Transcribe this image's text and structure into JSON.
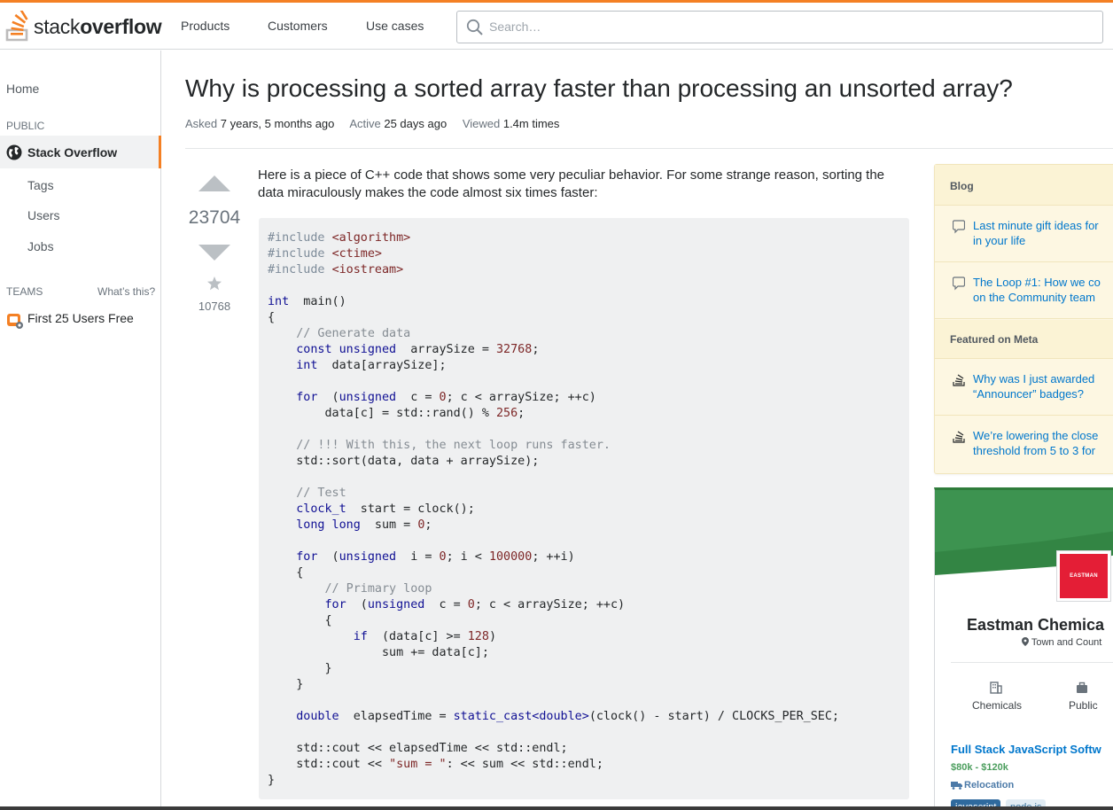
{
  "brand": {
    "logo_light": "stack",
    "logo_bold": "overflow"
  },
  "header": {
    "nav": [
      "Products",
      "Customers",
      "Use cases"
    ],
    "search_placeholder": "Search…",
    "accent_color": "#f48024"
  },
  "sidebar": {
    "home": "Home",
    "public_label": "PUBLIC",
    "stackoverflow": "Stack Overflow",
    "tags": "Tags",
    "users": "Users",
    "jobs": "Jobs",
    "teams_label": "TEAMS",
    "whats_this": "What’s this?",
    "teams_free": "First 25 Users Free"
  },
  "question": {
    "title": "Why is processing a sorted array faster than processing an unsorted array?",
    "asked_label": "Asked",
    "asked_value": "7 years, 5 months ago",
    "active_label": "Active",
    "active_value": "25 days ago",
    "viewed_label": "Viewed",
    "viewed_value": "1.4m times",
    "votes": "23704",
    "favorites": "10768",
    "intro": "Here is a piece of C++ code that shows some very peculiar behavior. For some strange reason, sorting the data miraculously makes the code almost six times faster:",
    "code_lines": [
      [
        [
          "pp",
          "#include "
        ],
        [
          "st",
          "<algorithm>"
        ]
      ],
      [
        [
          "pp",
          "#include "
        ],
        [
          "st",
          "<ctime>"
        ]
      ],
      [
        [
          "pp",
          "#include "
        ],
        [
          "st",
          "<iostream>"
        ]
      ],
      [],
      [
        [
          "kw",
          "int"
        ],
        [
          "",
          "  main()"
        ]
      ],
      [
        [
          "",
          "{"
        ]
      ],
      [
        [
          "cm",
          "    // Generate data"
        ]
      ],
      [
        [
          "kw",
          "    const unsigned"
        ],
        [
          "",
          "  arraySize = "
        ],
        [
          "nm",
          "32768"
        ],
        [
          "",
          ";"
        ]
      ],
      [
        [
          "kw",
          "    int"
        ],
        [
          "",
          "  data[arraySize];"
        ]
      ],
      [],
      [
        [
          "kw",
          "    for"
        ],
        [
          "",
          "  ("
        ],
        [
          "kw",
          "unsigned"
        ],
        [
          "",
          "  c = "
        ],
        [
          "nm",
          "0"
        ],
        [
          "",
          "; c < arraySize; ++c)"
        ]
      ],
      [
        [
          "",
          "        data[c] = std::rand() % "
        ],
        [
          "nm",
          "256"
        ],
        [
          "",
          ";"
        ]
      ],
      [],
      [
        [
          "cm",
          "    // !!! With this, the next loop runs faster."
        ]
      ],
      [
        [
          "",
          "    std::sort(data, data + arraySize);"
        ]
      ],
      [],
      [
        [
          "cm",
          "    // Test"
        ]
      ],
      [
        [
          "kw",
          "    clock_t"
        ],
        [
          "",
          "  start = clock();"
        ]
      ],
      [
        [
          "kw",
          "    long long"
        ],
        [
          "",
          "  sum = "
        ],
        [
          "nm",
          "0"
        ],
        [
          "",
          ";"
        ]
      ],
      [],
      [
        [
          "kw",
          "    for"
        ],
        [
          "",
          "  ("
        ],
        [
          "kw",
          "unsigned"
        ],
        [
          "",
          "  i = "
        ],
        [
          "nm",
          "0"
        ],
        [
          "",
          "; i < "
        ],
        [
          "nm",
          "100000"
        ],
        [
          "",
          "; ++i)"
        ]
      ],
      [
        [
          "",
          "    {"
        ]
      ],
      [
        [
          "cm",
          "        // Primary loop"
        ]
      ],
      [
        [
          "kw",
          "        for"
        ],
        [
          "",
          "  ("
        ],
        [
          "kw",
          "unsigned"
        ],
        [
          "",
          "  c = "
        ],
        [
          "nm",
          "0"
        ],
        [
          "",
          "; c < arraySize; ++c)"
        ]
      ],
      [
        [
          "",
          "        {"
        ]
      ],
      [
        [
          "kw",
          "            if"
        ],
        [
          "",
          "  (data[c] >= "
        ],
        [
          "nm",
          "128"
        ],
        [
          "",
          ")"
        ]
      ],
      [
        [
          "",
          "                sum += data[c];"
        ]
      ],
      [
        [
          "",
          "        }"
        ]
      ],
      [
        [
          "",
          "    }"
        ]
      ],
      [],
      [
        [
          "kw",
          "    double"
        ],
        [
          "",
          "  elapsedTime = "
        ],
        [
          "kw",
          "static_cast<double>"
        ],
        [
          "",
          "(clock() - start) / CLOCKS_PER_SEC;"
        ]
      ],
      [],
      [
        [
          "",
          "    std::cout << elapsedTime << std::endl;"
        ]
      ],
      [
        [
          "",
          "    std::cout << "
        ],
        [
          "st",
          "\"sum = \""
        ],
        [
          "",
          ": << sum << std::endl;"
        ]
      ],
      [
        [
          "",
          "}"
        ]
      ]
    ]
  },
  "blog": {
    "heading": "Blog",
    "items": [
      "Last minute gift ideas for",
      "in your life",
      "The Loop #1: How we co",
      "on the Community team"
    ]
  },
  "meta": {
    "heading": "Featured on Meta",
    "items": [
      "Why was I just awarded",
      "“Announcer” badges?",
      "We’re lowering the close",
      "threshold from 5 to 3 for"
    ]
  },
  "job": {
    "logo_text": "EASTMAN",
    "company": "Eastman Chemica",
    "location": "Town and Count",
    "category1": "Chemicals",
    "category2": "Public",
    "title": "Full Stack JavaScript Softw",
    "salary": "$80k - $120k",
    "relocation": "Relocation",
    "tags": [
      "javascript",
      "node.js"
    ]
  }
}
